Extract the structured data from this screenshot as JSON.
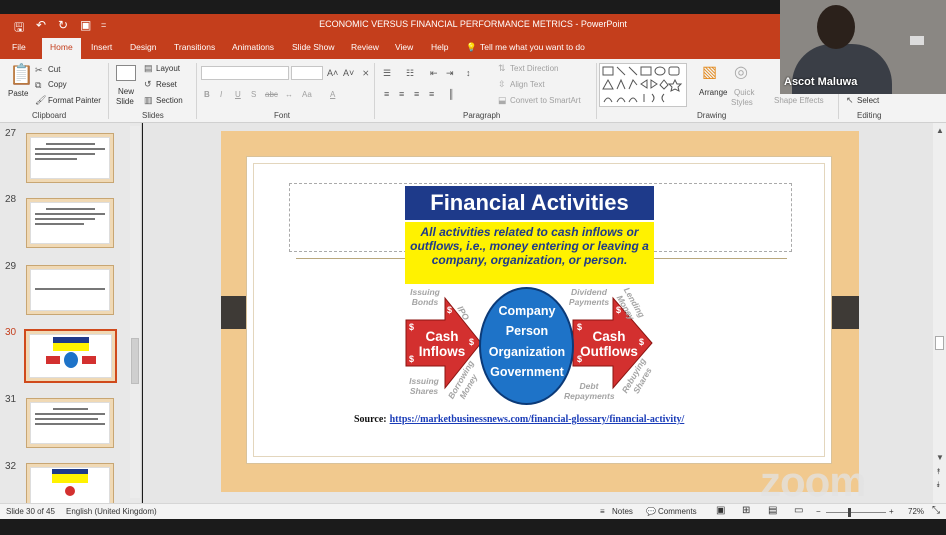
{
  "window": {
    "title": "ECONOMIC VERSUS FINANCIAL PERFORMANCE METRICS - PowerPoint"
  },
  "quick_access": {
    "save_icon": "save-icon",
    "undo_icon": "undo-icon",
    "redo_icon": "redo-icon",
    "present_icon": "start-from-beginning-icon",
    "customize": "="
  },
  "tabs": [
    "File",
    "Home",
    "Insert",
    "Design",
    "Transitions",
    "Animations",
    "Slide Show",
    "Review",
    "View",
    "Help"
  ],
  "tell_me": "Tell me what you want to do",
  "ribbon": {
    "clipboard": {
      "paste": "Paste",
      "cut": "Cut",
      "copy": "Copy",
      "format_painter": "Format Painter",
      "label": "Clipboard"
    },
    "slides": {
      "new_slide_1": "New",
      "new_slide_2": "Slide",
      "layout": "Layout",
      "reset": "Reset",
      "section": "Section",
      "label": "Slides"
    },
    "font": {
      "label": "Font",
      "bold": "B",
      "italic": "I",
      "underline": "U",
      "shadow": "S",
      "strike": "abc",
      "aa": "Aa",
      "color": "A"
    },
    "paragraph": {
      "text_direction": "Text Direction",
      "align_text": "Align Text",
      "smartart": "Convert to SmartArt",
      "label": "Paragraph"
    },
    "drawing": {
      "arrange": "Arrange",
      "quick_styles_1": "Quick",
      "quick_styles_2": "Styles",
      "shape_effects": "Shape Effects",
      "label": "Drawing"
    },
    "editing": {
      "select": "Select",
      "label": "Editing"
    }
  },
  "thumbnails": [
    {
      "num": "27"
    },
    {
      "num": "28"
    },
    {
      "num": "29"
    },
    {
      "num": "30",
      "selected": true
    },
    {
      "num": "31"
    },
    {
      "num": "32"
    }
  ],
  "slide": {
    "title": "Financial Activities",
    "description": "All activities related to cash inflows or outflows, i.e., money entering or leaving a company, organization, or person.",
    "entities": [
      "Company",
      "Person",
      "Organization",
      "Government"
    ],
    "cash_inflows": [
      "Cash",
      "Inflows"
    ],
    "cash_outflows": [
      "Cash",
      "Outflows"
    ],
    "inflow_items": [
      "Issuing Bonds",
      "IPO",
      "Issuing Shares",
      "Borrowing Money"
    ],
    "outflow_items": [
      "Dividend Payments",
      "Lending Money",
      "Debt Repayments",
      "Rebuying Shares"
    ],
    "source_label": "Source:",
    "source_url": "https://marketbusinessnews.com/financial-glossary/financial-activity/"
  },
  "status": {
    "slide": "Slide 30 of 45",
    "language": "English (United Kingdom)",
    "notes": "Notes",
    "comments": "Comments",
    "zoom": "72%"
  },
  "webcam": {
    "name": "Ascot Maluwa"
  },
  "watermark": "zoom",
  "colors": {
    "accent": "#c43e1c",
    "slide_title_bg": "#1e3a8a",
    "slide_desc_bg": "#fff200",
    "arrow_red": "#d3302f",
    "ellipse_blue": "#1e73c8"
  }
}
